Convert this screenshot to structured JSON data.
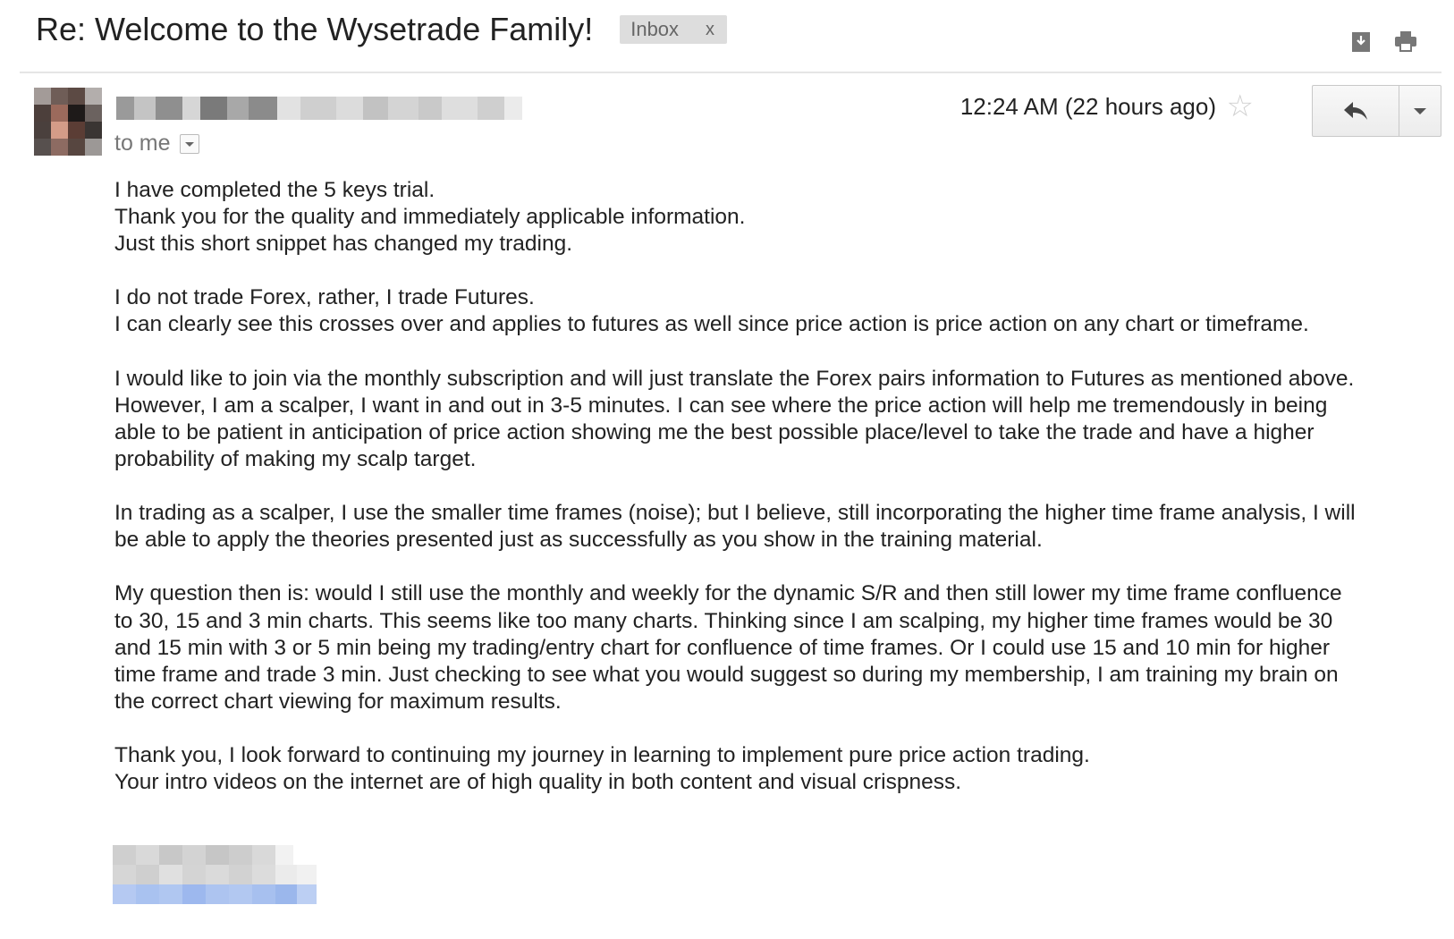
{
  "email": {
    "subject": "Re: Welcome to the Wysetrade Family!",
    "label": "Inbox",
    "label_remove": "x",
    "recipient": "to me",
    "timestamp": "12:24 AM (22 hours ago)",
    "paragraphs": [
      [
        "I have completed the 5 keys trial.",
        "Thank you for the quality and immediately applicable information.",
        "Just this short snippet has changed my trading."
      ],
      [
        "I do not trade Forex, rather, I trade Futures.",
        "I can clearly see this crosses over and applies to futures as well since price action is price action on any chart or timeframe."
      ],
      [
        "I would like to join via the monthly subscription and will just translate the Forex pairs information to Futures as mentioned above.",
        "However, I am a scalper, I want in and out in 3-5 minutes.  I can see where the price action will help me tremendously in being",
        "able to be patient in anticipation of price action showing me the best possible place/level to take the trade and have a higher",
        "probability of making my scalp target."
      ],
      [
        "In trading as a scalper, I use the smaller time frames (noise); but I believe, still incorporating the higher time frame analysis, I will",
        "be able to apply the theories presented just as successfully as you show in the training material."
      ],
      [
        "My question then is:  would I still use the monthly and weekly for the dynamic S/R and then still lower my time frame confluence",
        "to 30, 15 and 3 min charts.  This seems like too many charts.  Thinking since I am scalping, my higher time frames would be 30",
        "and 15 min with 3 or 5 min being my trading/entry chart for confluence of time frames.  Or I could use 15 and 10 min for higher",
        "time frame and trade 3 min.  Just checking to see what you would suggest so during my membership, I am training my brain on",
        "the correct chart viewing for maximum results."
      ],
      [
        "Thank you, I look forward to continuing my journey in learning to implement pure price action trading.",
        "Your intro videos on the internet are of high quality in both content and visual crispness."
      ]
    ]
  },
  "icons": {
    "download": "download-icon",
    "print": "print-icon",
    "star": "star-icon",
    "reply": "reply-icon",
    "more": "chevron-down-icon"
  },
  "colors": {
    "text": "#222222",
    "muted": "#777777",
    "chip_bg": "#dddddd",
    "signature_link": "#a9c2f0"
  }
}
